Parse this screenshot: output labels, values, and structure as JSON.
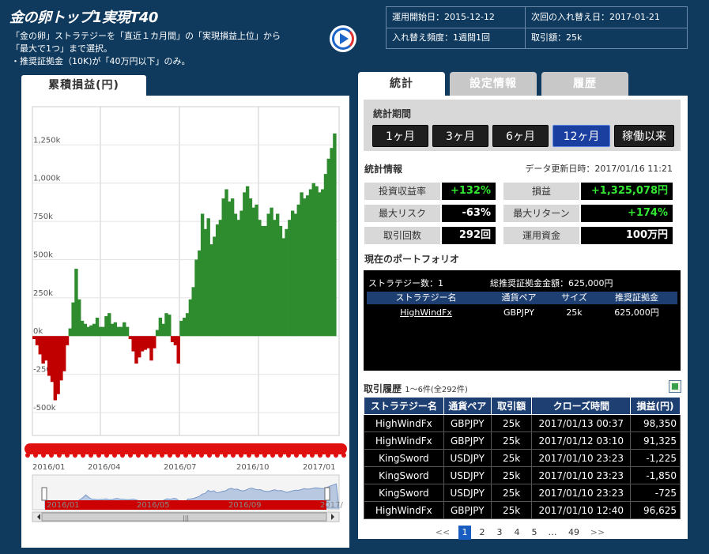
{
  "header": {
    "title": "金の卵トップ1実現T40",
    "desc_lines": [
      "「金の卵」ストラテジーを「直近１カ月間」の「実現損益上位」から",
      "「最大で1つ」まで選択。",
      "・推奨証拠金（10K)が「40万円以下」のみ。"
    ],
    "play_icon": "play-refresh-icon"
  },
  "info": {
    "start_date": "運用開始日：2015-12-12",
    "next_swap": "次回の入れ替え日：2017-01-21",
    "swap_freq": "入れ替え頻度：1週間1回",
    "amount": "取引額：25k"
  },
  "left": {
    "tab_label": "累積損益(円)",
    "chart_data": {
      "type": "bar",
      "title": "",
      "ylabel": "",
      "ylim": [
        -650000,
        1500000
      ],
      "yticks": [
        "1,250k",
        "1,000k",
        "750k",
        "500k",
        "250k",
        "0k",
        "-250k",
        "-500k"
      ],
      "ytick_values": [
        1250000,
        1000000,
        750000,
        500000,
        250000,
        0,
        -250000,
        -500000
      ],
      "xticks": [
        "2016/01",
        "2016/04",
        "2016/07",
        "2016/10",
        "2017/01"
      ],
      "positive_color": "#2e8b2e",
      "negative_color": "#c00000",
      "values": [
        -20000,
        -60000,
        -120000,
        -180000,
        -160000,
        -260000,
        -300000,
        -420000,
        -380000,
        -290000,
        -230000,
        -60000,
        50000,
        220000,
        440000,
        240000,
        100000,
        80000,
        60000,
        70000,
        80000,
        120000,
        60000,
        60000,
        130000,
        150000,
        80000,
        90000,
        60000,
        60000,
        90000,
        60000,
        -20000,
        -100000,
        -180000,
        -140000,
        -100000,
        -90000,
        -80000,
        -160000,
        -80000,
        40000,
        120000,
        80000,
        150000,
        140000,
        -40000,
        -60000,
        -180000,
        100000,
        120000,
        150000,
        240000,
        320000,
        500000,
        560000,
        800000,
        700000,
        770000,
        600000,
        650000,
        730000,
        760000,
        900000,
        960000,
        880000,
        900000,
        800000,
        760000,
        820000,
        940000,
        980000,
        900000,
        840000,
        860000,
        760000,
        720000,
        720000,
        800000,
        840000,
        760000,
        800000,
        720000,
        640000,
        700000,
        760000,
        820000,
        800000,
        860000,
        940000,
        900000,
        920000,
        960000,
        1000000,
        980000,
        940000,
        960000,
        1060000,
        1160000,
        1230000,
        1325078
      ],
      "navigator_labels": [
        "2016/01",
        "2016/05",
        "2016/09",
        "2017/"
      ]
    }
  },
  "tabs": {
    "stats": "統計",
    "settings": "設定情報",
    "history": "履歴"
  },
  "period": {
    "label": "統計期間",
    "buttons": [
      "1ヶ月",
      "3ヶ月",
      "6ヶ月",
      "12ヶ月",
      "稼働以来"
    ],
    "selected": "12ヶ月"
  },
  "stats": {
    "title": "統計情報",
    "updated": "データ更新日時：2017/01/16 11:21",
    "roi_label": "投資収益率",
    "roi_value": "+132%",
    "pl_label": "損益",
    "pl_value": "+1,325,078円",
    "maxrisk_label": "最大リスク",
    "maxrisk_value": "-63%",
    "maxreturn_label": "最大リターン",
    "maxreturn_value": "+174%",
    "trades_label": "取引回数",
    "trades_value": "292回",
    "capital_label": "運用資金",
    "capital_value": "100万円",
    "positive_color": "#32e832",
    "negative_color": "#ffffff"
  },
  "portfolio": {
    "title": "現在のポートフォリオ",
    "count": "ストラテジー数：1",
    "total_margin": "総推奨証拠金金額：625,000円",
    "headers": [
      "ストラテジー名",
      "通貨ペア",
      "サイズ",
      "推奨証拠金"
    ],
    "rows": [
      [
        "HighWindFx",
        "GBPJPY",
        "25k",
        "625,000円"
      ]
    ]
  },
  "history": {
    "title": "取引履歴",
    "subtitle": "1〜6件(全292件)",
    "export_icon": "excel-export-icon",
    "headers": [
      "ストラテジー名",
      "通貨ペア",
      "取引額",
      "クローズ時間",
      "損益(円)"
    ],
    "rows": [
      {
        "name": "HighWindFx",
        "pair": "GBPJPY",
        "size": "25k",
        "time": "2017/01/13 00:37",
        "pl": "98,350",
        "positive": true
      },
      {
        "name": "HighWindFx",
        "pair": "GBPJPY",
        "size": "25k",
        "time": "2017/01/12 03:10",
        "pl": "91,325",
        "positive": true
      },
      {
        "name": "KingSword",
        "pair": "USDJPY",
        "size": "25k",
        "time": "2017/01/10 23:23",
        "pl": "-1,225",
        "positive": false
      },
      {
        "name": "KingSword",
        "pair": "USDJPY",
        "size": "25k",
        "time": "2017/01/10 23:23",
        "pl": "-1,850",
        "positive": false
      },
      {
        "name": "KingSword",
        "pair": "USDJPY",
        "size": "25k",
        "time": "2017/01/10 23:23",
        "pl": "-725",
        "positive": false
      },
      {
        "name": "HighWindFx",
        "pair": "GBPJPY",
        "size": "25k",
        "time": "2017/01/10 12:40",
        "pl": "96,625",
        "positive": true
      }
    ]
  },
  "pager": {
    "prev": "<<",
    "pages": [
      "1",
      "2",
      "3",
      "4",
      "5"
    ],
    "ellipsis": "…",
    "last": "49",
    "next": ">>",
    "current": "1"
  }
}
